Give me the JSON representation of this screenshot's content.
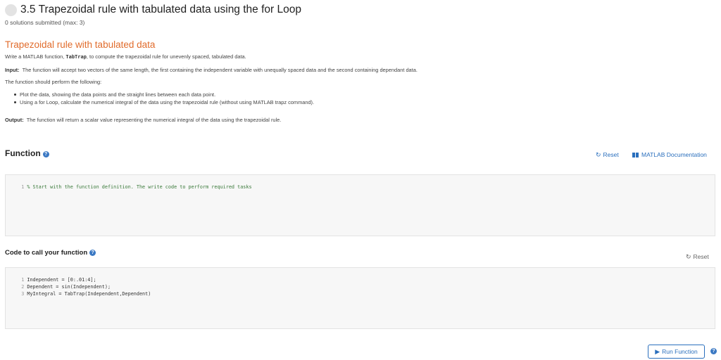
{
  "header": {
    "title": "3.5 Trapezoidal rule with tabulated data using the for Loop",
    "submitted": "0 solutions submitted (max: 3)"
  },
  "problem": {
    "title": "Trapezoidal rule with tabulated data",
    "intro_prefix": "Write a MATLAB function, ",
    "intro_code": "TabTrap",
    "intro_suffix": ", to compute the trapezoidal rule for unevenly spaced, tabulated data.",
    "input_label": "Input:",
    "input_text": "The function will accept two vectors of the same length, the first containing the independent variable with unequally spaced data and the second containing dependant data.",
    "perform_text": "The function should perform the following:",
    "bullets": [
      "Plot the data, showing the data points and the straight lines between each data point.",
      "Using a for Loop, calculate the numerical integral of the data using the trapezoidal rule (without using MATLAB trapz command)."
    ],
    "output_label": "Output:",
    "output_text": "The function will return a scalar value representing the numerical integral of the data using the trapezoidal rule."
  },
  "function_section": {
    "heading": "Function",
    "reset_label": "Reset",
    "docs_label": "MATLAB Documentation",
    "code_lines": [
      {
        "num": "1",
        "text": "% Start with the function definition. The write code to perform required tasks"
      }
    ]
  },
  "call_section": {
    "heading": "Code to call your function",
    "reset_label": "Reset",
    "code_lines": [
      {
        "num": "1",
        "text": "Independent = [0:.01:4];"
      },
      {
        "num": "2",
        "text": "Dependent = sin(Independent);"
      },
      {
        "num": "3",
        "text": "MyIntegral = TabTrap(Independent,Dependent)"
      }
    ]
  },
  "run_button": {
    "label": "Run Function"
  },
  "colors": {
    "accent_orange": "#e16c2c",
    "link_blue": "#2a6fbd",
    "editor_bg": "#f7f7f7"
  },
  "icons": {
    "reset": "circular-arrow-icon",
    "docs": "book-icon",
    "help": "question-circle-icon",
    "run": "play-triangle-icon"
  }
}
